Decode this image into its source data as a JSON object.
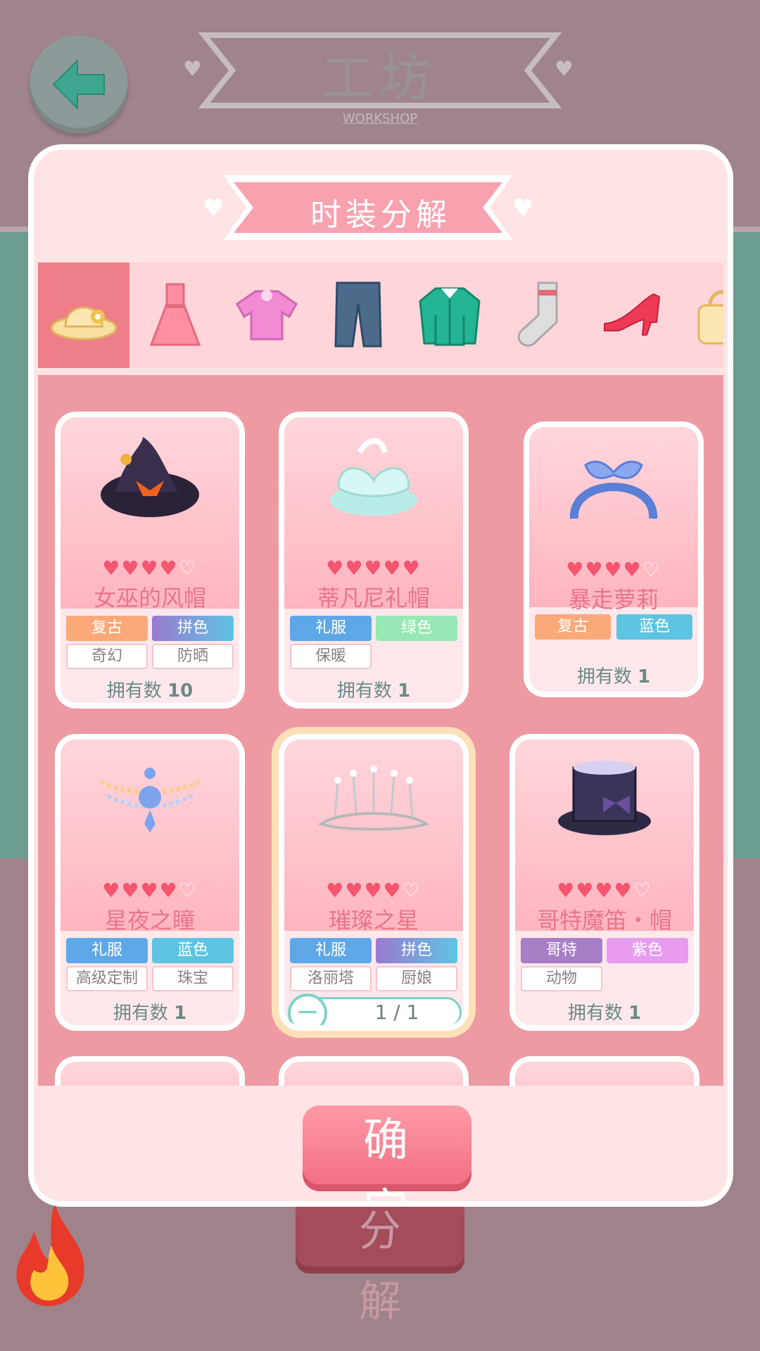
{
  "header": {
    "title": "工坊",
    "subtitle": "WORKSHOP"
  },
  "background_button": {
    "label": "分 解"
  },
  "dialog": {
    "title": "时装分解",
    "tabs": [
      {
        "icon": "hat-icon",
        "active": true
      },
      {
        "icon": "dress-icon",
        "active": false
      },
      {
        "icon": "top-icon",
        "active": false
      },
      {
        "icon": "pants-icon",
        "active": false
      },
      {
        "icon": "coat-icon",
        "active": false
      },
      {
        "icon": "sock-icon",
        "active": false
      },
      {
        "icon": "high-heel-icon",
        "active": false
      },
      {
        "icon": "bag-icon",
        "active": false
      }
    ],
    "owned_prefix": "拥有数",
    "items": [
      {
        "name": "女巫的风帽",
        "hearts": 4,
        "tags": [
          "复古",
          "拼色",
          "奇幻",
          "防晒"
        ],
        "owned": "10"
      },
      {
        "name": "蒂凡尼礼帽",
        "hearts": 4.5,
        "tags": [
          "礼服",
          "绿色",
          "保暖"
        ],
        "owned": "1"
      },
      {
        "name": "暴走萝莉",
        "hearts": 4,
        "tags": [
          "复古",
          "蓝色"
        ],
        "owned": "1"
      },
      {
        "name": "星夜之瞳",
        "hearts": 4,
        "tags": [
          "礼服",
          "蓝色",
          "高级定制",
          "珠宝"
        ],
        "owned": "1"
      },
      {
        "name": "璀璨之星",
        "hearts": 4,
        "tags": [
          "礼服",
          "拼色",
          "洛丽塔",
          "厨娘"
        ],
        "selected_count": "1 / 1"
      },
      {
        "name": "哥特魔笛・帽",
        "hearts": 3.5,
        "tags": [
          "哥特",
          "紫色",
          "动物"
        ],
        "owned": "1"
      }
    ],
    "confirm_label": "确 定"
  },
  "colors": {
    "tag_retro": "#fba978",
    "tag_mixed": "#9b7ad0",
    "tag_dress": "#5fa8e8",
    "tag_green": "#96e8b4",
    "tag_blue": "#5ec4e2",
    "tag_gothic": "#a67fc4",
    "tag_purple": "#e89cf0",
    "accent": "#f37084"
  }
}
